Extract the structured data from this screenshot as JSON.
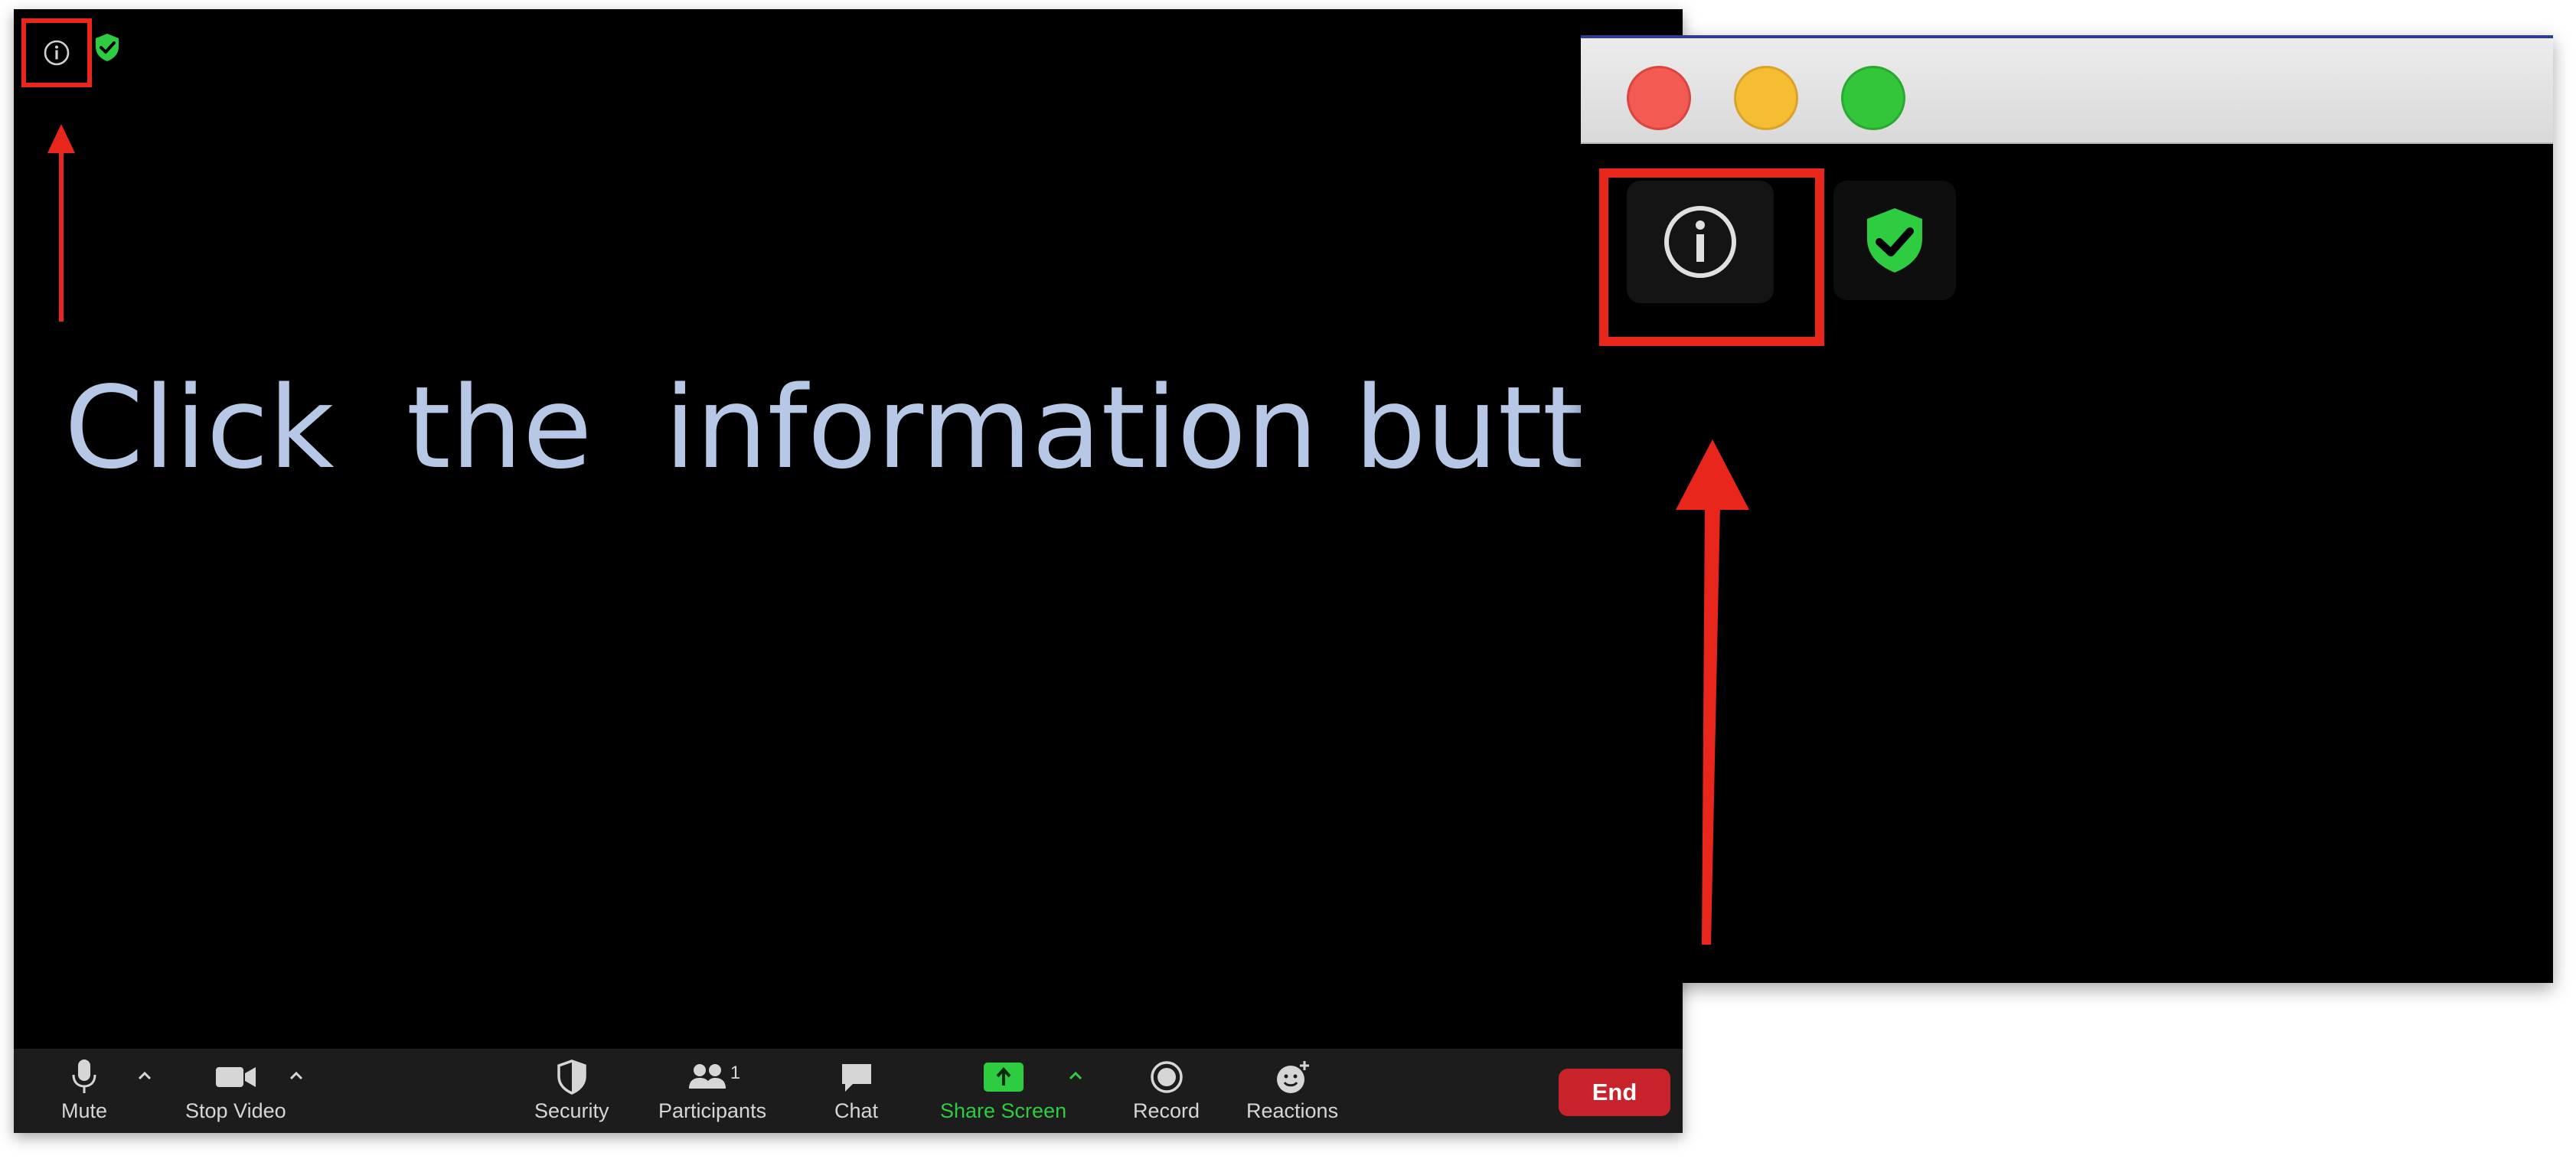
{
  "instruction": "Click  the  information button.",
  "toolbar": {
    "mute_label": "Mute",
    "stop_video_label": "Stop Video",
    "security_label": "Security",
    "participants_label": "Participants",
    "participants_count": "1",
    "chat_label": "Chat",
    "share_screen_label": "Share Screen",
    "record_label": "Record",
    "reactions_label": "Reactions",
    "end_label": "End"
  },
  "icons": {
    "info": "info-icon",
    "security": "shield-check-icon",
    "arrow": "red-arrow-up",
    "window_controls": [
      "close",
      "minimize",
      "maximize"
    ]
  },
  "colors": {
    "highlight": "#e8261c",
    "instruction_text": "#b7c8e6",
    "share_screen": "#2ecc40",
    "end_button": "#c8222a",
    "shield": "#2ecc40"
  }
}
